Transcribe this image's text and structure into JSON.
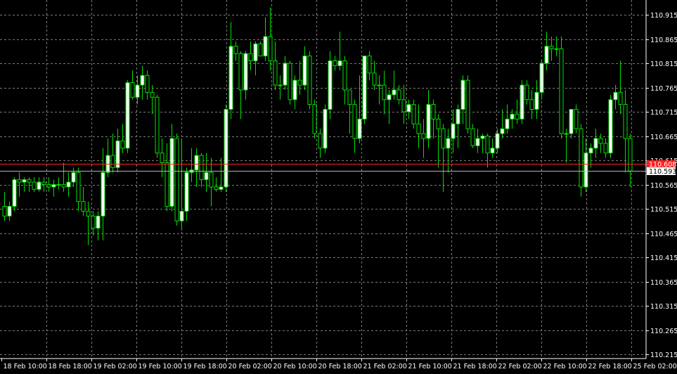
{
  "chart_data": {
    "type": "candlestick",
    "title": "",
    "xlabel": "",
    "ylabel": "",
    "ylim": [
      110.21,
      110.94
    ],
    "grid": true,
    "colors": {
      "background": "#000000",
      "grid": "#7a7a7a",
      "candle": "#00e000",
      "bull_body": "#ffffff",
      "bear_body": "#000000",
      "axis_text": "#ffffff",
      "ask_line": "#ff2020",
      "bid_line": "#b4b4b4"
    },
    "y_ticks": [
      "110.915",
      "110.865",
      "110.815",
      "110.765",
      "110.715",
      "110.665",
      "110.615",
      "110.565",
      "110.515",
      "110.465",
      "110.415",
      "110.365",
      "110.315",
      "110.265",
      "110.215"
    ],
    "x_ticks": [
      "18 Feb 10:00",
      "18 Feb 18:00",
      "19 Feb 02:00",
      "19 Feb 10:00",
      "19 Feb 18:00",
      "20 Feb 02:00",
      "20 Feb 10:00",
      "20 Feb 18:00",
      "21 Feb 02:00",
      "21 Feb 10:00",
      "21 Feb 18:00",
      "22 Feb 02:00",
      "22 Feb 10:00",
      "22 Feb 18:00",
      "25 Feb 02:00"
    ],
    "ask_price": "110.608",
    "bid_price": "110.593",
    "candles": [
      {
        "o": 110.52,
        "h": 110.55,
        "l": 110.49,
        "c": 110.5
      },
      {
        "o": 110.5,
        "h": 110.53,
        "l": 110.49,
        "c": 110.52
      },
      {
        "o": 110.52,
        "h": 110.58,
        "l": 110.51,
        "c": 110.575
      },
      {
        "o": 110.575,
        "h": 110.59,
        "l": 110.54,
        "c": 110.57
      },
      {
        "o": 110.57,
        "h": 110.58,
        "l": 110.55,
        "c": 110.575
      },
      {
        "o": 110.575,
        "h": 110.58,
        "l": 110.55,
        "c": 110.57
      },
      {
        "o": 110.57,
        "h": 110.58,
        "l": 110.55,
        "c": 110.555
      },
      {
        "o": 110.555,
        "h": 110.58,
        "l": 110.55,
        "c": 110.57
      },
      {
        "o": 110.57,
        "h": 110.58,
        "l": 110.55,
        "c": 110.565
      },
      {
        "o": 110.565,
        "h": 110.58,
        "l": 110.55,
        "c": 110.56
      },
      {
        "o": 110.56,
        "h": 110.575,
        "l": 110.54,
        "c": 110.565
      },
      {
        "o": 110.565,
        "h": 110.58,
        "l": 110.555,
        "c": 110.565
      },
      {
        "o": 110.565,
        "h": 110.61,
        "l": 110.55,
        "c": 110.56
      },
      {
        "o": 110.56,
        "h": 110.59,
        "l": 110.54,
        "c": 110.57
      },
      {
        "o": 110.57,
        "h": 110.6,
        "l": 110.56,
        "c": 110.59
      },
      {
        "o": 110.59,
        "h": 110.6,
        "l": 110.51,
        "c": 110.53
      },
      {
        "o": 110.53,
        "h": 110.56,
        "l": 110.5,
        "c": 110.51
      },
      {
        "o": 110.51,
        "h": 110.53,
        "l": 110.44,
        "c": 110.5
      },
      {
        "o": 110.5,
        "h": 110.51,
        "l": 110.46,
        "c": 110.475
      },
      {
        "o": 110.475,
        "h": 110.51,
        "l": 110.45,
        "c": 110.5
      },
      {
        "o": 110.5,
        "h": 110.64,
        "l": 110.45,
        "c": 110.59
      },
      {
        "o": 110.59,
        "h": 110.66,
        "l": 110.58,
        "c": 110.625
      },
      {
        "o": 110.625,
        "h": 110.67,
        "l": 110.59,
        "c": 110.6
      },
      {
        "o": 110.6,
        "h": 110.68,
        "l": 110.59,
        "c": 110.655
      },
      {
        "o": 110.655,
        "h": 110.69,
        "l": 110.63,
        "c": 110.64
      },
      {
        "o": 110.64,
        "h": 110.78,
        "l": 110.63,
        "c": 110.775
      },
      {
        "o": 110.775,
        "h": 110.8,
        "l": 110.74,
        "c": 110.745
      },
      {
        "o": 110.745,
        "h": 110.79,
        "l": 110.73,
        "c": 110.77
      },
      {
        "o": 110.77,
        "h": 110.81,
        "l": 110.74,
        "c": 110.79
      },
      {
        "o": 110.79,
        "h": 110.8,
        "l": 110.74,
        "c": 110.755
      },
      {
        "o": 110.755,
        "h": 110.77,
        "l": 110.71,
        "c": 110.745
      },
      {
        "o": 110.745,
        "h": 110.75,
        "l": 110.62,
        "c": 110.63
      },
      {
        "o": 110.63,
        "h": 110.66,
        "l": 110.58,
        "c": 110.61
      },
      {
        "o": 110.61,
        "h": 110.65,
        "l": 110.51,
        "c": 110.52
      },
      {
        "o": 110.52,
        "h": 110.69,
        "l": 110.51,
        "c": 110.66
      },
      {
        "o": 110.66,
        "h": 110.67,
        "l": 110.48,
        "c": 110.49
      },
      {
        "o": 110.49,
        "h": 110.66,
        "l": 110.47,
        "c": 110.51
      },
      {
        "o": 110.51,
        "h": 110.6,
        "l": 110.49,
        "c": 110.59
      },
      {
        "o": 110.59,
        "h": 110.64,
        "l": 110.57,
        "c": 110.595
      },
      {
        "o": 110.595,
        "h": 110.64,
        "l": 110.56,
        "c": 110.625
      },
      {
        "o": 110.625,
        "h": 110.63,
        "l": 110.56,
        "c": 110.575
      },
      {
        "o": 110.575,
        "h": 110.63,
        "l": 110.55,
        "c": 110.59
      },
      {
        "o": 110.59,
        "h": 110.62,
        "l": 110.52,
        "c": 110.56
      },
      {
        "o": 110.56,
        "h": 110.58,
        "l": 110.55,
        "c": 110.555
      },
      {
        "o": 110.555,
        "h": 110.62,
        "l": 110.55,
        "c": 110.56
      },
      {
        "o": 110.56,
        "h": 110.73,
        "l": 110.55,
        "c": 110.72
      },
      {
        "o": 110.72,
        "h": 110.9,
        "l": 110.7,
        "c": 110.85
      },
      {
        "o": 110.85,
        "h": 110.86,
        "l": 110.82,
        "c": 110.835
      },
      {
        "o": 110.835,
        "h": 110.84,
        "l": 110.7,
        "c": 110.76
      },
      {
        "o": 110.76,
        "h": 110.84,
        "l": 110.74,
        "c": 110.835
      },
      {
        "o": 110.835,
        "h": 110.86,
        "l": 110.8,
        "c": 110.82
      },
      {
        "o": 110.82,
        "h": 110.86,
        "l": 110.79,
        "c": 110.855
      },
      {
        "o": 110.855,
        "h": 110.86,
        "l": 110.83,
        "c": 110.83
      },
      {
        "o": 110.83,
        "h": 110.91,
        "l": 110.82,
        "c": 110.87
      },
      {
        "o": 110.87,
        "h": 110.93,
        "l": 110.8,
        "c": 110.82
      },
      {
        "o": 110.82,
        "h": 110.86,
        "l": 110.76,
        "c": 110.77
      },
      {
        "o": 110.77,
        "h": 110.79,
        "l": 110.74,
        "c": 110.77
      },
      {
        "o": 110.77,
        "h": 110.83,
        "l": 110.76,
        "c": 110.815
      },
      {
        "o": 110.815,
        "h": 110.82,
        "l": 110.73,
        "c": 110.74
      },
      {
        "o": 110.74,
        "h": 110.79,
        "l": 110.72,
        "c": 110.78
      },
      {
        "o": 110.78,
        "h": 110.82,
        "l": 110.75,
        "c": 110.77
      },
      {
        "o": 110.77,
        "h": 110.85,
        "l": 110.76,
        "c": 110.83
      },
      {
        "o": 110.83,
        "h": 110.84,
        "l": 110.72,
        "c": 110.73
      },
      {
        "o": 110.73,
        "h": 110.74,
        "l": 110.66,
        "c": 110.67
      },
      {
        "o": 110.67,
        "h": 110.68,
        "l": 110.62,
        "c": 110.64
      },
      {
        "o": 110.64,
        "h": 110.73,
        "l": 110.63,
        "c": 110.72
      },
      {
        "o": 110.72,
        "h": 110.84,
        "l": 110.7,
        "c": 110.82
      },
      {
        "o": 110.82,
        "h": 110.83,
        "l": 110.8,
        "c": 110.81
      },
      {
        "o": 110.81,
        "h": 110.88,
        "l": 110.8,
        "c": 110.82
      },
      {
        "o": 110.82,
        "h": 110.83,
        "l": 110.73,
        "c": 110.76
      },
      {
        "o": 110.76,
        "h": 110.76,
        "l": 110.67,
        "c": 110.73
      },
      {
        "o": 110.73,
        "h": 110.74,
        "l": 110.63,
        "c": 110.66
      },
      {
        "o": 110.66,
        "h": 110.79,
        "l": 110.65,
        "c": 110.7
      },
      {
        "o": 110.7,
        "h": 110.83,
        "l": 110.69,
        "c": 110.83
      },
      {
        "o": 110.83,
        "h": 110.84,
        "l": 110.78,
        "c": 110.795
      },
      {
        "o": 110.795,
        "h": 110.82,
        "l": 110.76,
        "c": 110.77
      },
      {
        "o": 110.77,
        "h": 110.79,
        "l": 110.73,
        "c": 110.77
      },
      {
        "o": 110.77,
        "h": 110.8,
        "l": 110.71,
        "c": 110.74
      },
      {
        "o": 110.74,
        "h": 110.76,
        "l": 110.69,
        "c": 110.75
      },
      {
        "o": 110.75,
        "h": 110.8,
        "l": 110.74,
        "c": 110.76
      },
      {
        "o": 110.76,
        "h": 110.77,
        "l": 110.73,
        "c": 110.74
      },
      {
        "o": 110.74,
        "h": 110.77,
        "l": 110.69,
        "c": 110.715
      },
      {
        "o": 110.715,
        "h": 110.74,
        "l": 110.7,
        "c": 110.73
      },
      {
        "o": 110.73,
        "h": 110.74,
        "l": 110.68,
        "c": 110.69
      },
      {
        "o": 110.69,
        "h": 110.73,
        "l": 110.64,
        "c": 110.67
      },
      {
        "o": 110.67,
        "h": 110.7,
        "l": 110.62,
        "c": 110.66
      },
      {
        "o": 110.66,
        "h": 110.76,
        "l": 110.64,
        "c": 110.73
      },
      {
        "o": 110.73,
        "h": 110.74,
        "l": 110.66,
        "c": 110.7
      },
      {
        "o": 110.7,
        "h": 110.71,
        "l": 110.6,
        "c": 110.68
      },
      {
        "o": 110.68,
        "h": 110.69,
        "l": 110.55,
        "c": 110.64
      },
      {
        "o": 110.64,
        "h": 110.68,
        "l": 110.59,
        "c": 110.66
      },
      {
        "o": 110.66,
        "h": 110.72,
        "l": 110.63,
        "c": 110.69
      },
      {
        "o": 110.69,
        "h": 110.73,
        "l": 110.64,
        "c": 110.72
      },
      {
        "o": 110.72,
        "h": 110.79,
        "l": 110.69,
        "c": 110.78
      },
      {
        "o": 110.78,
        "h": 110.79,
        "l": 110.67,
        "c": 110.68
      },
      {
        "o": 110.68,
        "h": 110.69,
        "l": 110.64,
        "c": 110.645
      },
      {
        "o": 110.645,
        "h": 110.68,
        "l": 110.63,
        "c": 110.66
      },
      {
        "o": 110.66,
        "h": 110.67,
        "l": 110.63,
        "c": 110.665
      },
      {
        "o": 110.665,
        "h": 110.67,
        "l": 110.6,
        "c": 110.63
      },
      {
        "o": 110.63,
        "h": 110.66,
        "l": 110.62,
        "c": 110.64
      },
      {
        "o": 110.64,
        "h": 110.68,
        "l": 110.63,
        "c": 110.67
      },
      {
        "o": 110.67,
        "h": 110.72,
        "l": 110.66,
        "c": 110.68
      },
      {
        "o": 110.68,
        "h": 110.73,
        "l": 110.67,
        "c": 110.7
      },
      {
        "o": 110.7,
        "h": 110.72,
        "l": 110.68,
        "c": 110.71
      },
      {
        "o": 110.71,
        "h": 110.74,
        "l": 110.69,
        "c": 110.7
      },
      {
        "o": 110.7,
        "h": 110.78,
        "l": 110.69,
        "c": 110.77
      },
      {
        "o": 110.77,
        "h": 110.78,
        "l": 110.73,
        "c": 110.74
      },
      {
        "o": 110.74,
        "h": 110.76,
        "l": 110.7,
        "c": 110.72
      },
      {
        "o": 110.72,
        "h": 110.78,
        "l": 110.7,
        "c": 110.755
      },
      {
        "o": 110.755,
        "h": 110.82,
        "l": 110.74,
        "c": 110.815
      },
      {
        "o": 110.815,
        "h": 110.88,
        "l": 110.8,
        "c": 110.85
      },
      {
        "o": 110.85,
        "h": 110.87,
        "l": 110.82,
        "c": 110.845
      },
      {
        "o": 110.845,
        "h": 110.87,
        "l": 110.83,
        "c": 110.845
      },
      {
        "o": 110.845,
        "h": 110.87,
        "l": 110.66,
        "c": 110.67
      },
      {
        "o": 110.67,
        "h": 110.68,
        "l": 110.61,
        "c": 110.67
      },
      {
        "o": 110.67,
        "h": 110.71,
        "l": 110.66,
        "c": 110.72
      },
      {
        "o": 110.72,
        "h": 110.73,
        "l": 110.67,
        "c": 110.68
      },
      {
        "o": 110.68,
        "h": 110.69,
        "l": 110.54,
        "c": 110.56
      },
      {
        "o": 110.56,
        "h": 110.66,
        "l": 110.55,
        "c": 110.63
      },
      {
        "o": 110.63,
        "h": 110.65,
        "l": 110.6,
        "c": 110.64
      },
      {
        "o": 110.64,
        "h": 110.68,
        "l": 110.62,
        "c": 110.66
      },
      {
        "o": 110.66,
        "h": 110.67,
        "l": 110.63,
        "c": 110.65
      },
      {
        "o": 110.65,
        "h": 110.66,
        "l": 110.62,
        "c": 110.63
      },
      {
        "o": 110.63,
        "h": 110.75,
        "l": 110.62,
        "c": 110.74
      },
      {
        "o": 110.74,
        "h": 110.77,
        "l": 110.72,
        "c": 110.755
      },
      {
        "o": 110.755,
        "h": 110.82,
        "l": 110.71,
        "c": 110.73
      },
      {
        "o": 110.73,
        "h": 110.76,
        "l": 110.59,
        "c": 110.66
      },
      {
        "o": 110.66,
        "h": 110.67,
        "l": 110.56,
        "c": 110.593
      }
    ]
  }
}
